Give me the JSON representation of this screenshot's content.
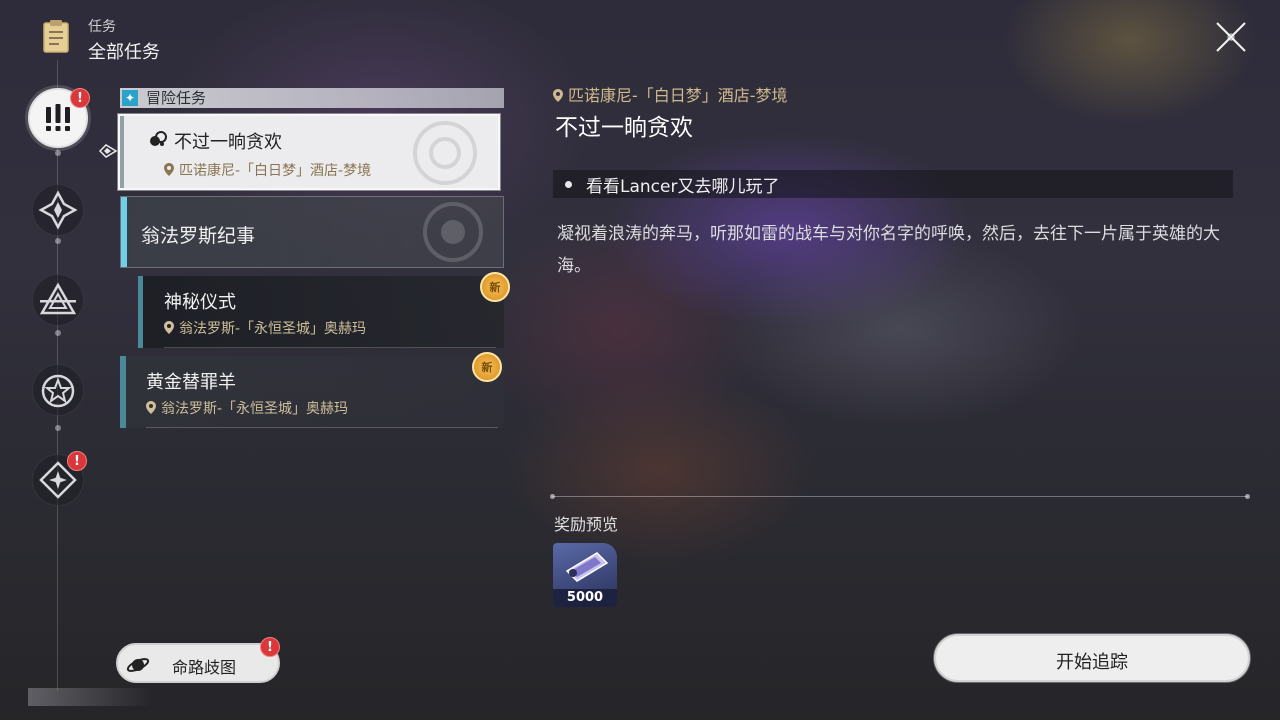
{
  "header": {
    "subtitle": "任务",
    "title": "全部任务"
  },
  "rail": {
    "items": [
      {
        "icon": "adventure-mission-icon",
        "badge": "!",
        "active": true
      },
      {
        "icon": "trailblaze-mission-icon",
        "badge": "",
        "active": false
      },
      {
        "icon": "companion-mission-icon",
        "badge": "",
        "active": false
      },
      {
        "icon": "daily-mission-icon",
        "badge": "",
        "active": false
      },
      {
        "icon": "event-mission-icon",
        "badge": "!",
        "active": false
      }
    ]
  },
  "list": {
    "category": "冒险任务",
    "selected": {
      "title": "不过一晌贪欢",
      "location": "匹诺康尼-「白日梦」酒店-梦境"
    },
    "group": {
      "title": "翁法罗斯纪事"
    },
    "sub_items": [
      {
        "title": "神秘仪式",
        "location": "翁法罗斯-「永恒圣城」奥赫玛",
        "badge": "新"
      },
      {
        "title": "黄金替罪羊",
        "location": "翁法罗斯-「永恒圣城」奥赫玛",
        "badge": "新"
      }
    ]
  },
  "detail": {
    "location": "匹诺康尼-「白日梦」酒店-梦境",
    "title": "不过一晌贪欢",
    "objective": "看看Lancer又去哪儿玩了",
    "description": "凝视着浪涛的奔马，听那如雷的战车与对你名字的呼唤，然后，去往下一片属于英雄的大海。",
    "reward_label": "奖励预览",
    "rewards": [
      {
        "icon": "trailblaze-exp-ticket-icon",
        "quantity": "5000"
      }
    ]
  },
  "buttons": {
    "map": {
      "label": "命路歧图",
      "badge": "!"
    },
    "track": {
      "label": "开始追踪"
    }
  },
  "colors": {
    "accent_cyan": "#6fd0e8",
    "location_gold": "#cfb98e",
    "badge_red": "#d9373a",
    "new_badge_gold": "#e39a2d"
  }
}
